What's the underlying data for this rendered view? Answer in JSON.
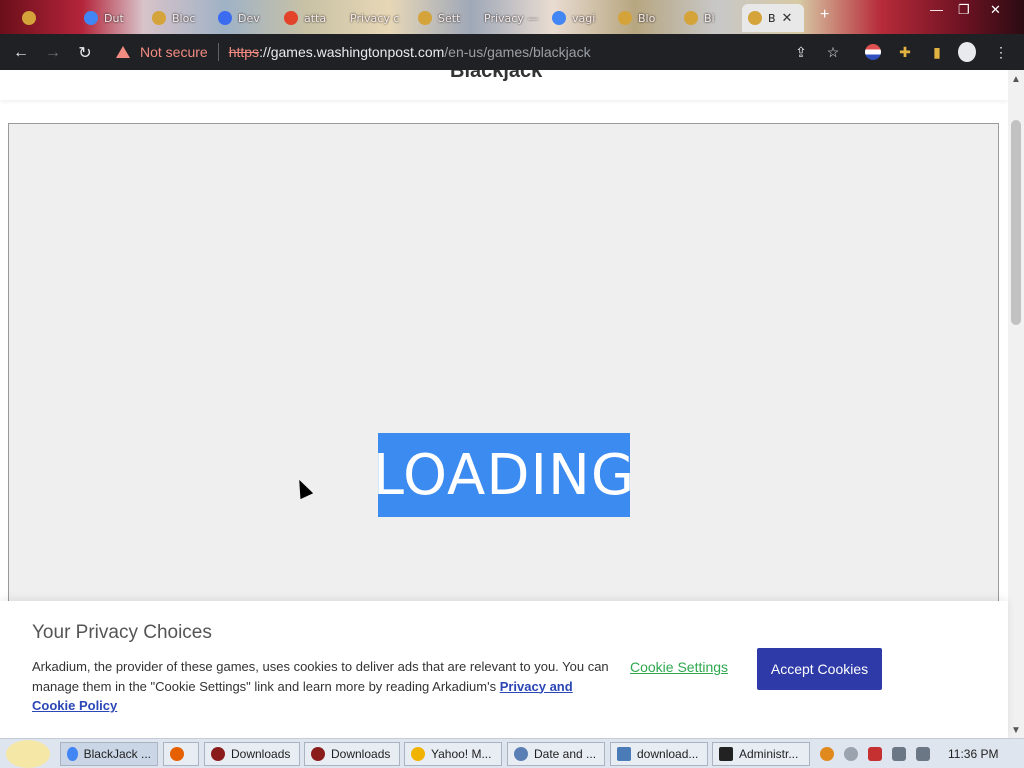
{
  "tabs": [
    {
      "label": "Dut",
      "icon": "google-icon",
      "color": "#4285f4"
    },
    {
      "label": "Bloc",
      "icon": "site-icon",
      "color": "#d4a33a"
    },
    {
      "label": "Dev",
      "icon": "site-icon",
      "color": "#3b6cf0"
    },
    {
      "label": "atta",
      "icon": "gitlab-icon",
      "color": "#e24329"
    },
    {
      "label": "Privacy c",
      "icon": "",
      "color": "#888888"
    },
    {
      "label": "Sett",
      "icon": "site-icon",
      "color": "#d4a33a"
    },
    {
      "label": "Privacy —",
      "icon": "",
      "color": "#888888"
    },
    {
      "label": "vagi",
      "icon": "google-icon",
      "color": "#4285f4"
    },
    {
      "label": "Blo",
      "icon": "site-icon",
      "color": "#d4a33a"
    },
    {
      "label": "Bl",
      "icon": "site-icon",
      "color": "#d4a33a"
    },
    {
      "label": "B",
      "icon": "site-icon",
      "color": "#d4a33a",
      "active": true
    }
  ],
  "address": {
    "security_label": "Not secure",
    "scheme": "https",
    "host": "://games.washingtonpost.com",
    "path": "/en-us/games/blackjack"
  },
  "page": {
    "title": "Blackjack",
    "loading_text": "LOADING"
  },
  "cookie": {
    "title": "Your Privacy Choices",
    "text": "Arkadium, the provider of these games, uses cookies to deliver ads that are relevant to you. You can manage them in the \"Cookie Settings\" link and learn more by reading Arkadium's",
    "link": "Privacy and Cookie Policy",
    "settings_label": "Cookie Settings",
    "accept_label": "Accept Cookies"
  },
  "taskbar": {
    "items": [
      {
        "label": "BlackJack ...",
        "icon": "chrome-icon",
        "color": "#4285f4",
        "active": true
      },
      {
        "label": "",
        "icon": "firefox-icon",
        "color": "#e66000"
      },
      {
        "label": "Downloads",
        "icon": "folder-icon",
        "color": "#8a1c1c"
      },
      {
        "label": "Downloads",
        "icon": "folder-icon",
        "color": "#8a1c1c"
      },
      {
        "label": "Yahoo! M...",
        "icon": "yahoo-icon",
        "color": "#f0b400"
      },
      {
        "label": "Date and ...",
        "icon": "clock-icon",
        "color": "#5a7fb4"
      },
      {
        "label": "download...",
        "icon": "window-icon",
        "color": "#4a7db8"
      },
      {
        "label": "Administr...",
        "icon": "cmd-icon",
        "color": "#222222"
      }
    ],
    "clock": "11:36 PM"
  }
}
